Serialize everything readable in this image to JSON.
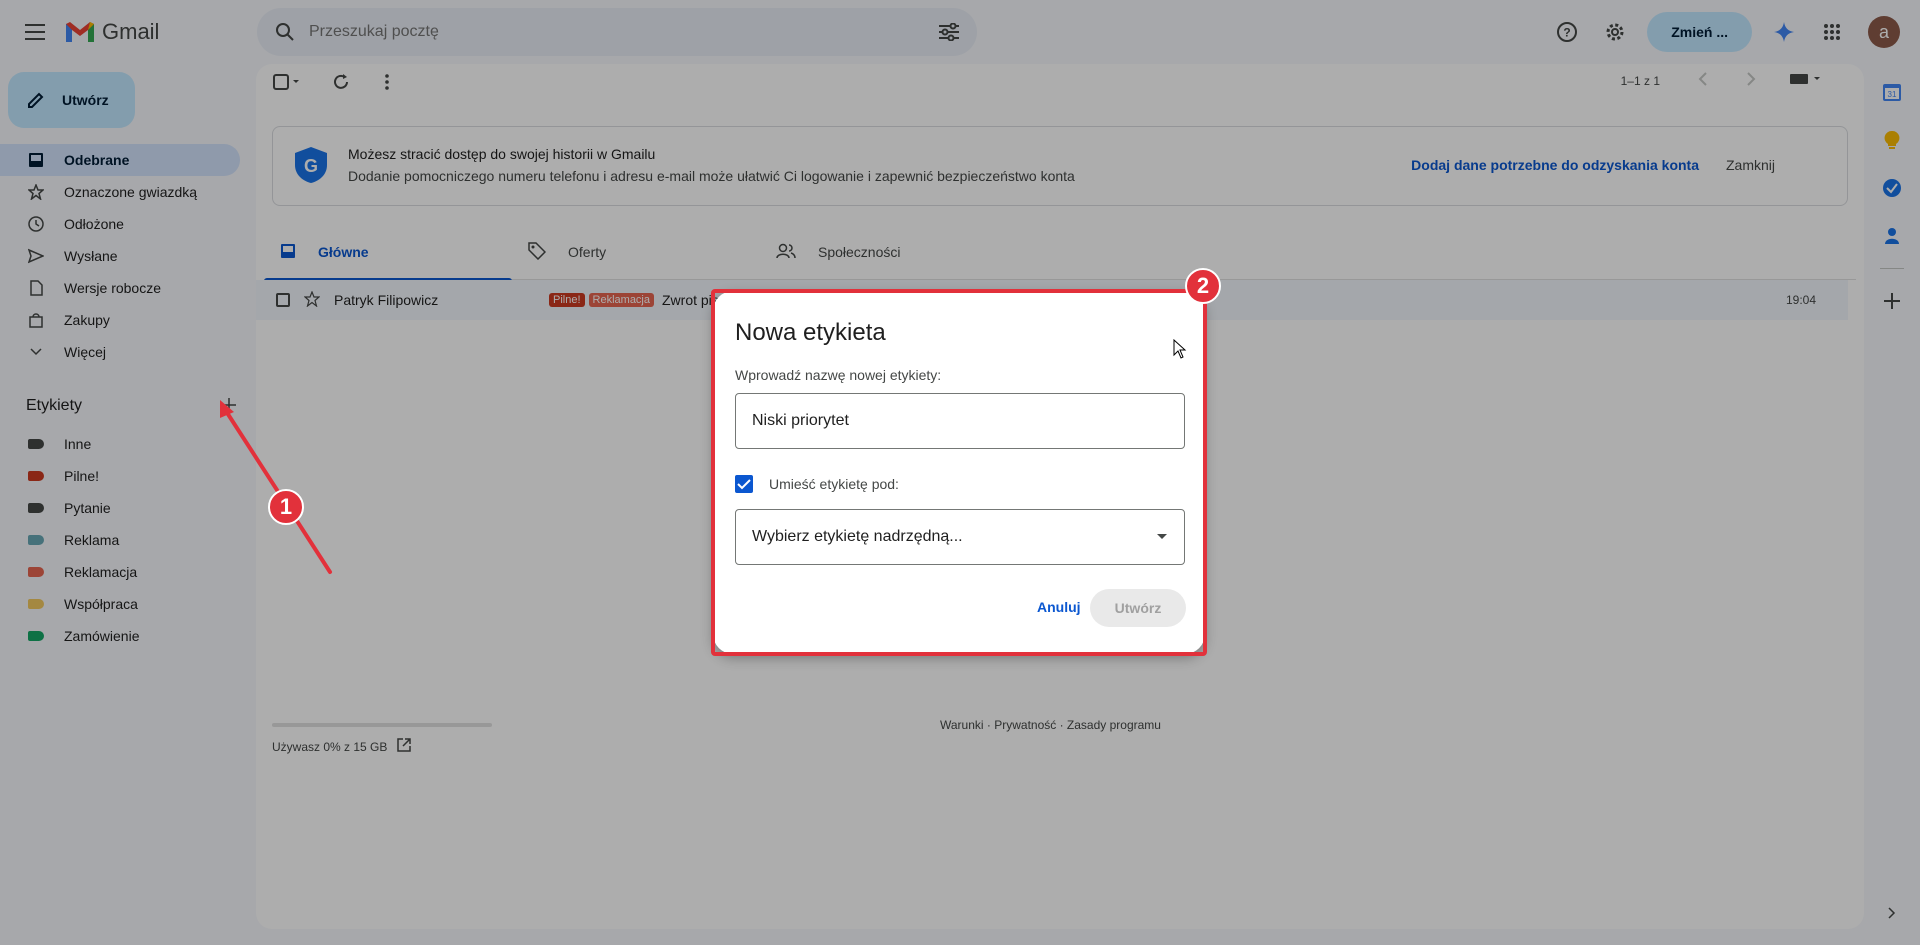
{
  "app": {
    "name": "Gmail"
  },
  "search": {
    "placeholder": "Przeszukaj pocztę"
  },
  "header": {
    "switch_label": "Zmień ...",
    "avatar_letter": "a"
  },
  "compose": {
    "label": "Utwórz"
  },
  "nav": {
    "items": [
      {
        "label": "Odebrane",
        "icon": "inbox-icon"
      },
      {
        "label": "Oznaczone gwiazdką",
        "icon": "star-icon"
      },
      {
        "label": "Odłożone",
        "icon": "clock-icon"
      },
      {
        "label": "Wysłane",
        "icon": "send-icon"
      },
      {
        "label": "Wersje robocze",
        "icon": "draft-icon"
      },
      {
        "label": "Zakupy",
        "icon": "shopping-icon"
      },
      {
        "label": "Więcej",
        "icon": "chevron-down-icon"
      }
    ]
  },
  "labels": {
    "title": "Etykiety",
    "items": [
      {
        "label": "Inne",
        "color": "#444746"
      },
      {
        "label": "Pilne!",
        "color": "#cc3a21"
      },
      {
        "label": "Pytanie",
        "color": "#444746"
      },
      {
        "label": "Reklama",
        "color": "#68a7b4"
      },
      {
        "label": "Reklamacja",
        "color": "#e66550"
      },
      {
        "label": "Współpraca",
        "color": "#f2c960"
      },
      {
        "label": "Zamówienie",
        "color": "#16a766"
      }
    ]
  },
  "toolbar": {
    "pagination": "1–1 z 1"
  },
  "banner": {
    "title": "Możesz stracić dostęp do swojej historii w Gmailu",
    "subtitle": "Dodanie pomocniczego numeru telefonu i adresu e-mail może ułatwić Ci logowanie i zapewnić bezpieczeństwo konta",
    "action": "Dodaj dane potrzebne do odzyskania konta",
    "close": "Zamknij"
  },
  "tabs": [
    {
      "label": "Główne"
    },
    {
      "label": "Oferty"
    },
    {
      "label": "Społeczności"
    }
  ],
  "mail": {
    "sender": "Patryk Filipowicz",
    "chips": [
      {
        "label": "Pilne!",
        "color": "#cc3a21"
      },
      {
        "label": "Reklamacja",
        "color": "#e66550"
      }
    ],
    "subject": "Zwrot pie",
    "time": "19:04"
  },
  "storage": {
    "text": "Używasz 0% z 15 GB",
    "percent": 0
  },
  "footer": {
    "links": "Warunki · Prywatność · Zasady programu"
  },
  "dialog": {
    "title": "Nowa etykieta",
    "prompt": "Wprowadź nazwę nowej etykiety:",
    "input_value": "Niski priorytet",
    "nest_label": "Umieść etykietę pod:",
    "nest_checked": true,
    "parent_placeholder": "Wybierz etykietę nadrzędną...",
    "cancel": "Anuluj",
    "create": "Utwórz"
  },
  "annotations": {
    "marker1": "1",
    "marker2": "2",
    "color": "#e2313b"
  }
}
